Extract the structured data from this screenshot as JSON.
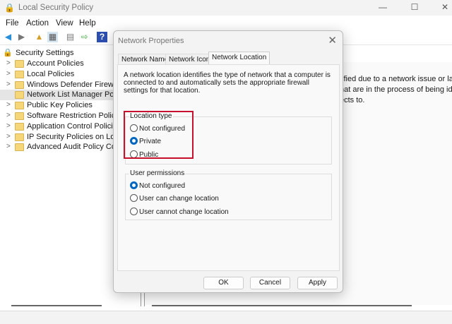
{
  "window": {
    "title": "Local Security Policy",
    "minimize": "—",
    "maximize": "☐",
    "close": "✕"
  },
  "menu": [
    "File",
    "Action",
    "View",
    "Help"
  ],
  "tree": {
    "root": "Security Settings",
    "items": [
      {
        "label": "Account Policies",
        "expandable": true
      },
      {
        "label": "Local Policies",
        "expandable": true
      },
      {
        "label": "Windows Defender Firewall with Advanced Security",
        "expandable": true
      },
      {
        "label": "Network List Manager Policies",
        "expandable": false,
        "selected": true
      },
      {
        "label": "Public Key Policies",
        "expandable": true
      },
      {
        "label": "Software Restriction Policies",
        "expandable": true
      },
      {
        "label": "Application Control Policies",
        "expandable": true
      },
      {
        "label": "IP Security Policies on Local Computer",
        "expandable": true
      },
      {
        "label": "Advanced Audit Policy Configuration",
        "expandable": true
      }
    ]
  },
  "right_pane": {
    "lines": [
      "tified due to a network issue or lack",
      "hat are in the process of being ident",
      "ects to."
    ]
  },
  "dialog": {
    "title": "Network Properties",
    "close": "✕",
    "tabs": [
      {
        "label": "Network Name"
      },
      {
        "label": "Network Icon"
      },
      {
        "label": "Network Location",
        "active": true
      }
    ],
    "description": "A network location identifies the type of network that a computer is connected to and automatically sets the appropriate firewall settings for that location.",
    "location_type": {
      "label": "Location type",
      "options": [
        {
          "label": "Not configured",
          "checked": false
        },
        {
          "label": "Private",
          "checked": true
        },
        {
          "label": "Public",
          "checked": false
        }
      ]
    },
    "user_permissions": {
      "label": "User permissions",
      "options": [
        {
          "label": "Not configured",
          "checked": true
        },
        {
          "label": "User can change location",
          "checked": false
        },
        {
          "label": "User cannot change location",
          "checked": false
        }
      ]
    },
    "buttons": {
      "ok": "OK",
      "cancel": "Cancel",
      "apply": "Apply"
    }
  },
  "colors": {
    "accent": "#0067c0",
    "highlight": "#c8102e"
  }
}
